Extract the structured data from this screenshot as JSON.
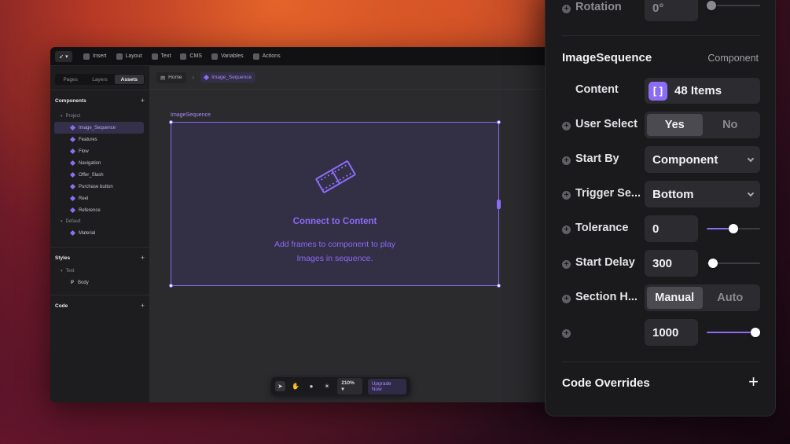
{
  "toolbar": {
    "items": [
      {
        "label": "Insert",
        "icon": "plus-icon"
      },
      {
        "label": "Layout",
        "icon": "layout-icon"
      },
      {
        "label": "Text",
        "icon": "text-icon"
      },
      {
        "label": "CMS",
        "icon": "cms-icon"
      },
      {
        "label": "Variables",
        "icon": "variables-icon"
      },
      {
        "label": "Actions",
        "icon": "actions-icon"
      }
    ]
  },
  "sidebar": {
    "tabs": [
      {
        "label": "Pages",
        "active": false
      },
      {
        "label": "Layers",
        "active": false
      },
      {
        "label": "Assets",
        "active": true
      }
    ],
    "components_title": "Components",
    "group_project": "Project",
    "project_items": [
      "Image_Sequence",
      "Features",
      "Flow",
      "Navigation",
      "Offer_Slash",
      "Purchase button",
      "Reel",
      "Reference"
    ],
    "group_default": "Default",
    "default_items": [
      "Material"
    ],
    "styles_title": "Styles",
    "styles_group": "Text",
    "styles_items": [
      "Body"
    ],
    "code_title": "Code",
    "plus": "+"
  },
  "breadcrumb": {
    "home": "Home",
    "current": "Image_Sequence",
    "sep": "›"
  },
  "canvas": {
    "frame_label": "ImageSequence",
    "title": "Connect to Content",
    "desc_line1": "Add frames to component to play",
    "desc_line2": "Images in sequence."
  },
  "bottombar": {
    "zoom": "210%",
    "upgrade": "Upgrade Now"
  },
  "props": {
    "rotation_label": "Rotation",
    "rotation_value": "0°",
    "component_name": "ImageSequence",
    "component_type": "Component",
    "content_label": "Content",
    "content_value": "48 Items",
    "user_select_label": "User Select",
    "user_select_options": [
      "Yes",
      "No"
    ],
    "user_select_selected": "Yes",
    "start_by_label": "Start By",
    "start_by_value": "Component",
    "trigger_label": "Trigger Se...",
    "trigger_value": "Bottom",
    "tolerance_label": "Tolerance",
    "tolerance_value": "0",
    "start_delay_label": "Start Delay",
    "start_delay_value": "300",
    "section_label": "Section H...",
    "section_options": [
      "Manual",
      "Auto"
    ],
    "section_selected": "Manual",
    "extra_value": "1000",
    "code_overrides_label": "Code Overrides",
    "plus": "+",
    "accent": "#8b6cf6"
  }
}
